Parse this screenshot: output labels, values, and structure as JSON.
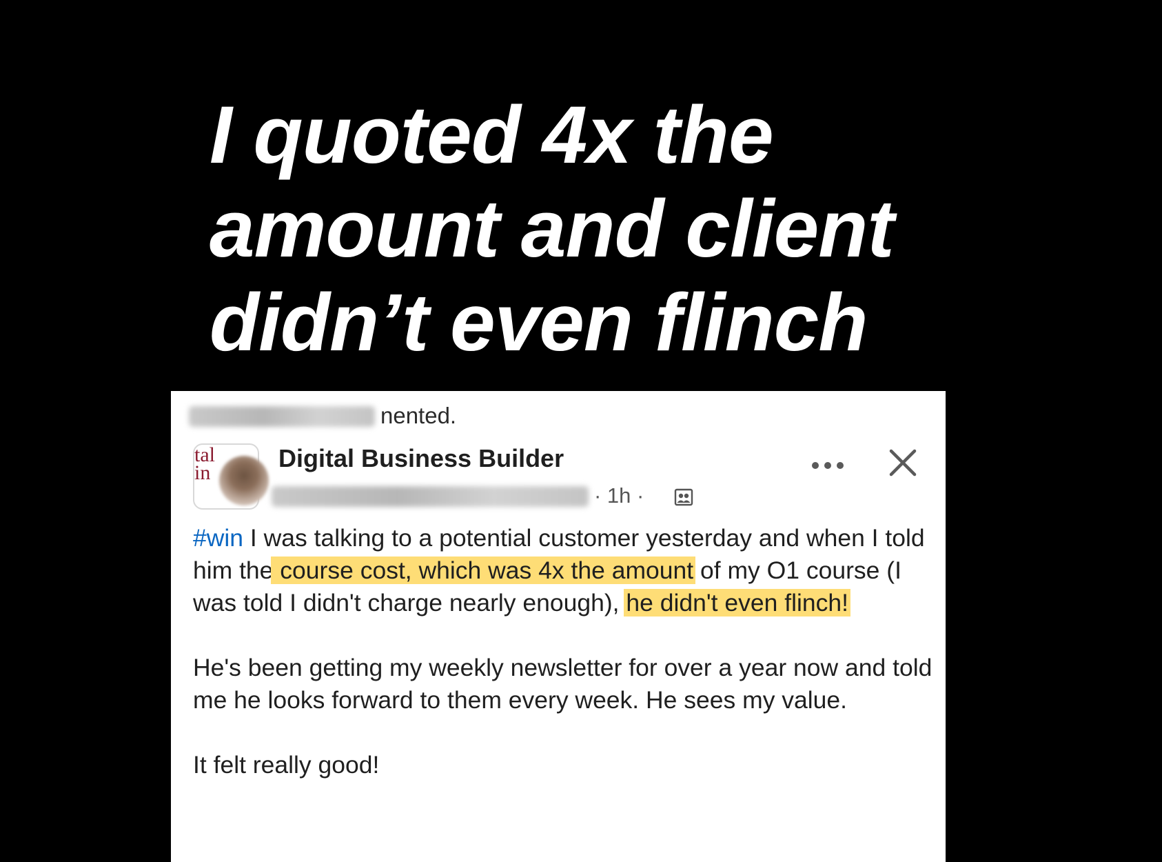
{
  "headline": {
    "lines": [
      "I quoted 4x the",
      "amount and client",
      "didn’t even flinch"
    ]
  },
  "post": {
    "activity_suffix": "nented.",
    "group_name": "Digital Business Builder",
    "logo_text": "tal\nin",
    "timestamp": "· 1h ·",
    "icons": {
      "more": "more-options-icon",
      "close": "close-icon",
      "group": "group-icon"
    },
    "body": {
      "hashtag": "#win",
      "p1_intro": " I was talking to a potential customer yesterday and when I told him the",
      "p1_highlight1": " course cost, which was 4x the amount",
      "p1_middle": " of my O1 course (I was told I didn't charge nearly enough), ",
      "p1_highlight2": "he didn't even flinch!",
      "p2": "He's been getting my weekly newsletter for over a year now and told me he looks forward to them every week. He sees my value.",
      "p3": "It felt really good!"
    },
    "colors": {
      "highlight": "#fedd76",
      "hashtag": "#0a66c2"
    }
  }
}
